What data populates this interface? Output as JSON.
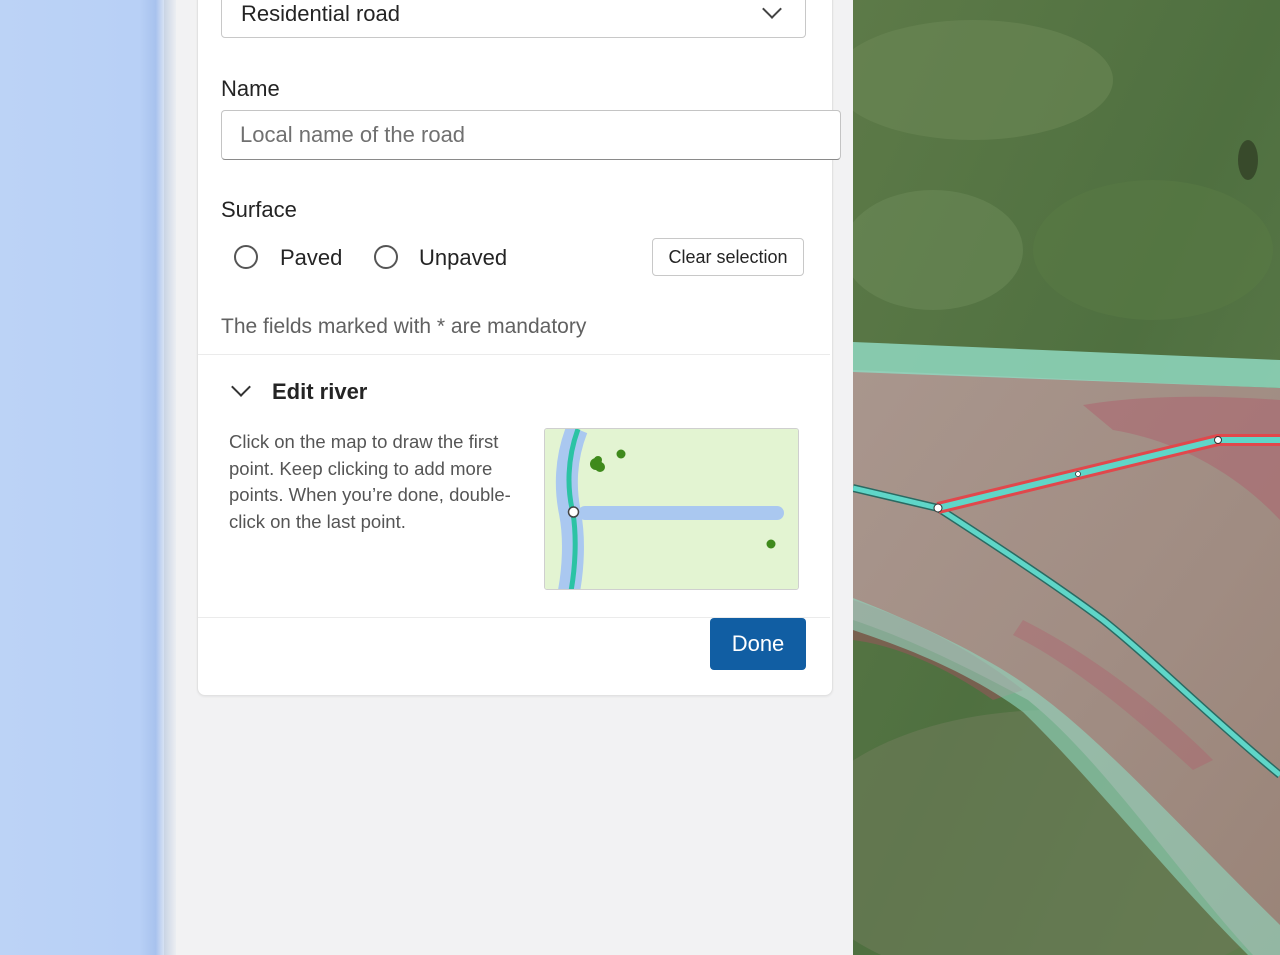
{
  "form": {
    "road_type": {
      "value": "Residential road"
    },
    "name": {
      "label": "Name",
      "placeholder": "Local name of the road",
      "value": ""
    },
    "surface": {
      "label": "Surface",
      "options": [
        "Paved",
        "Unpaved"
      ],
      "clear_label": "Clear selection"
    },
    "mandatory_hint": "The fields marked with * are mandatory"
  },
  "edit_river": {
    "title": "Edit river",
    "instructions": "Click on the map to draw the first point. Keep clicking to add more points. When you’re done, double-click on the last point."
  },
  "footer": {
    "done_label": "Done"
  },
  "icons": {
    "dropdown": "chevron-down-icon",
    "section": "chevron-down-icon"
  },
  "colors": {
    "primary": "#115ea3",
    "road_selected": "#e0484c",
    "waterway": "#5fd6c8",
    "grass_band": "#8fd8bf"
  }
}
